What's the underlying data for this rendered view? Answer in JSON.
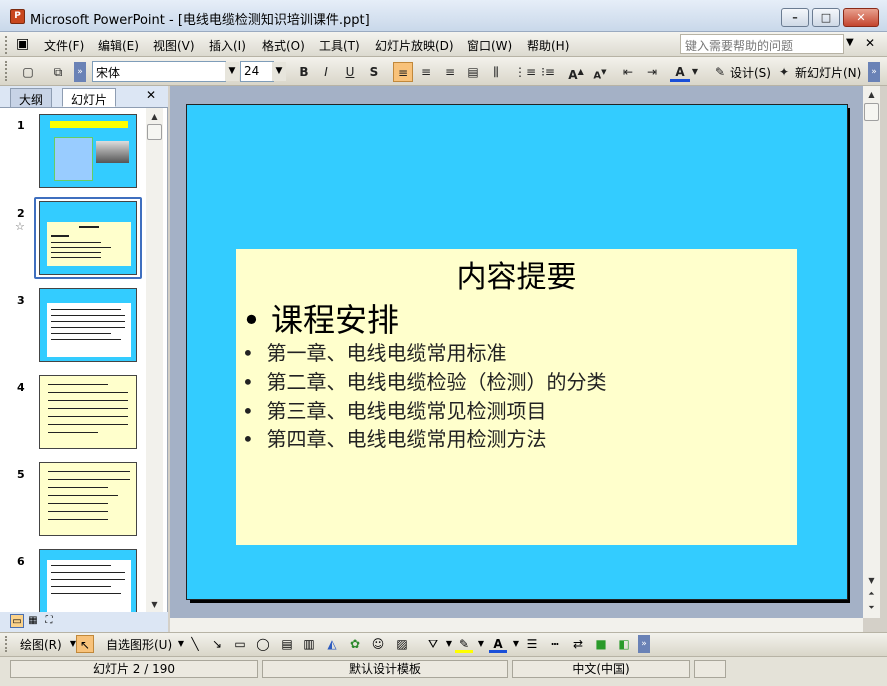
{
  "window": {
    "title": "Microsoft PowerPoint - [电线电缆检测知识培训课件.ppt]",
    "icon": "powerpoint-icon"
  },
  "menu": {
    "items": [
      "文件(F)",
      "编辑(E)",
      "视图(V)",
      "插入(I)",
      "格式(O)",
      "工具(T)",
      "幻灯片放映(D)",
      "窗口(W)",
      "帮助(H)"
    ],
    "help_placeholder": "键入需要帮助的问题"
  },
  "format_toolbar": {
    "font": "宋体",
    "size": "24",
    "bold": "B",
    "italic": "I",
    "underline": "U",
    "shadow": "S",
    "font_color_glyph": "A",
    "design_label": "设计(S)",
    "new_slide_label": "新幻灯片(N)"
  },
  "left_panel": {
    "tabs": [
      "大纲",
      "幻灯片"
    ],
    "selected_tab": "幻灯片",
    "slide_numbers": [
      "1",
      "2",
      "3",
      "4",
      "5",
      "6"
    ],
    "selected_slide": "2",
    "star_mark": "☆"
  },
  "slide": {
    "title": "内容提要",
    "main_bullet": "课程安排",
    "sub_bullets": [
      "第一章、电线电缆常用标准",
      "第二章、电线电缆检验（检测）的分类",
      "第三章、电线电缆常见检测项目",
      "第四章、电线电缆常用检测方法"
    ],
    "background_color": "#33ccff",
    "box_color": "#ffffcc"
  },
  "drawing_toolbar": {
    "draw_label": "绘图(R)",
    "autoshapes_label": "自选图形(U)"
  },
  "status": {
    "slide_info": "幻灯片 2 / 190",
    "template": "默认设计模板",
    "language": "中文(中国)"
  }
}
